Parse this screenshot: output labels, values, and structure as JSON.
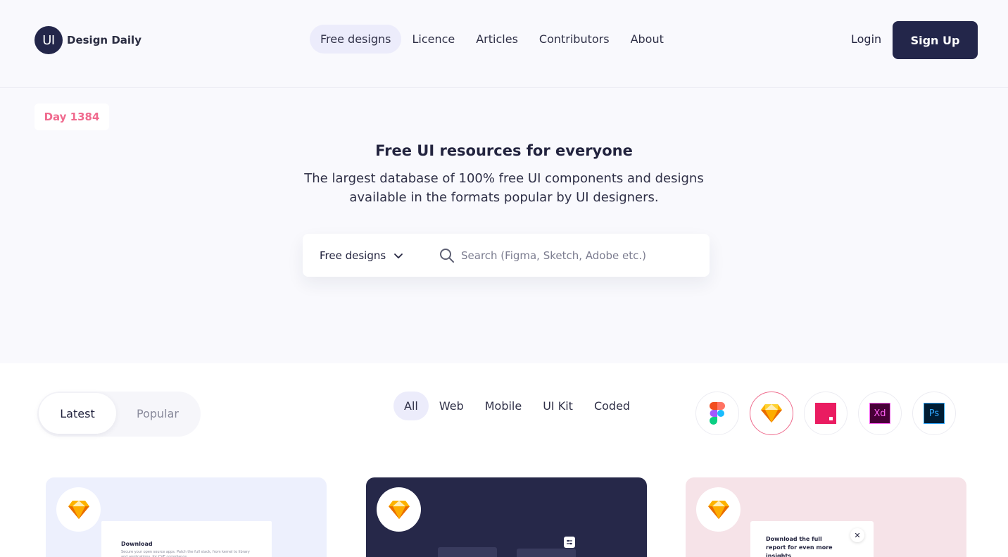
{
  "brand": {
    "badge": "UI",
    "name": "Design Daily"
  },
  "nav": {
    "items": [
      {
        "label": "Free designs",
        "active": true
      },
      {
        "label": "Licence",
        "active": false
      },
      {
        "label": "Articles",
        "active": false
      },
      {
        "label": "Contributors",
        "active": false
      },
      {
        "label": "About",
        "active": false
      }
    ],
    "login": "Login",
    "signup": "Sign Up"
  },
  "hero": {
    "day_badge": "Day 1384",
    "title": "Free UI resources for everyone",
    "subtitle": "The largest database of 100% free UI components and designs available in the formats popular by UI designers."
  },
  "search": {
    "select_value": "Free designs",
    "placeholder": "Search (Figma, Sketch, Adobe etc.)"
  },
  "sort_toggle": {
    "latest": "Latest",
    "popular": "Popular",
    "selected": "Latest"
  },
  "categories": [
    {
      "label": "All",
      "active": true
    },
    {
      "label": "Web",
      "active": false
    },
    {
      "label": "Mobile",
      "active": false
    },
    {
      "label": "UI Kit",
      "active": false
    },
    {
      "label": "Coded",
      "active": false
    }
  ],
  "tools": [
    {
      "icon": "figma-icon",
      "active": false
    },
    {
      "icon": "sketch-icon",
      "active": true
    },
    {
      "icon": "invision-studio-icon",
      "active": false
    },
    {
      "icon": "adobe-xd-icon",
      "label": "Xd",
      "active": false
    },
    {
      "icon": "photoshop-icon",
      "label": "Ps",
      "active": false
    }
  ],
  "cards": [
    {
      "tool_icon": "sketch-icon",
      "preview_title": "Download",
      "preview_text": "Secure your open source apps. Patch the full stack, from kernel to library and applications, for CVE compliance."
    },
    {
      "tool_icon": "sketch-icon"
    },
    {
      "tool_icon": "sketch-icon",
      "preview_text": "Download the full report for even more insights",
      "close_glyph": "✕"
    }
  ],
  "colors": {
    "primary": "#23264a",
    "accent_pink": "#f06a8e",
    "nav_active_bg": "#ececfb",
    "hero_bg": "#f9f9fd"
  }
}
